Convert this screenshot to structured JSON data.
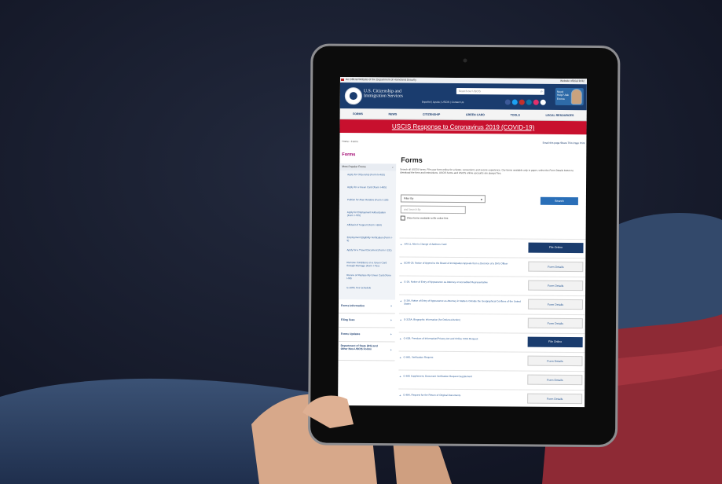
{
  "gov_banner": {
    "text": "An Official Website of the Department of Homeland Security",
    "right": "Website official foritz"
  },
  "header": {
    "brand": "U.S. Citizenship and Immigration Services",
    "search_placeholder": "Search our USCIS",
    "subline": "Español | Ayuda | USCIS | Contact Us",
    "help_text": "Need Help? Ask Emma"
  },
  "nav": [
    "FORMS",
    "NEWS",
    "CITIZENSHIP",
    "GREEN CARD",
    "TOOLS",
    "LEGAL RESOURCES"
  ],
  "alert": "USCIS Response to Coronavirus 2019 (COVID-19)",
  "breadcrumb": "Home › Forms",
  "utilities": "Email this page  Share This Page  Print",
  "sidebar": {
    "title": "Forms",
    "most_popular": "Most Popular Forms",
    "items": [
      "Apply for Citizenship (Form N-400)",
      "Apply for a Green Card (Form I-485)",
      "Petition for Alien Relative (Form I-130)",
      "Apply for Employment Authorization (Form I-765)",
      "Affidavit of Support (Form I-864)",
      "Employment Eligibility Verification (Form I-9)",
      "Apply for a Travel Document (Form I-131)",
      "Remove Conditions on a Green Card through Marriage (Form I-751)",
      "Renew or Replace My Green Card (Form I-90)",
      "G-1055, Fee Schedule"
    ],
    "sections": [
      "Forms Information",
      "Filing Fees",
      "Forms Updates",
      "Department of State (DS) and Other Non-USCIS Forms"
    ]
  },
  "main": {
    "title": "Forms",
    "intro": "Search all USCIS forms. File your form online for a faster, convenient, and secure experience. Our forms available only in paper, select the Form Details button to download the form and instructions. USCIS forms and USCIS online accounts are always free.",
    "filter_label": "Filter By",
    "keyword_placeholder": "and Search By",
    "checkbox_label": "Show forms available to file online first",
    "search_button": "Search",
    "rows": [
      {
        "label": "AR-11, Alien's Change of Address Card",
        "button": "File Online"
      },
      {
        "label": "EOIR-29, Notice of Appeal to the Board of Immigration Appeals from a Decision of a DHS Officer",
        "button": "Form Details"
      },
      {
        "label": "G-28, Notice of Entry of Appearance as Attorney or Accredited Representative",
        "button": "Form Details"
      },
      {
        "label": "G-28I, Notice of Entry of Appearance as Attorney in Matters Outside the Geographical Confines of the United States",
        "button": "Form Details"
      },
      {
        "label": "G-325A, Biographic Information (for Deferred Action)",
        "button": "Form Details"
      },
      {
        "label": "G-639, Freedom of Information/Privacy Act and Online FOIA Request",
        "button": "File Online"
      },
      {
        "label": "G-845, Verification Request",
        "button": "Form Details"
      },
      {
        "label": "G-845 Supplement, Document Verification Request Supplement",
        "button": "Form Details"
      },
      {
        "label": "G-884, Request for the Return of Original Documents",
        "button": "Form Details"
      }
    ]
  }
}
